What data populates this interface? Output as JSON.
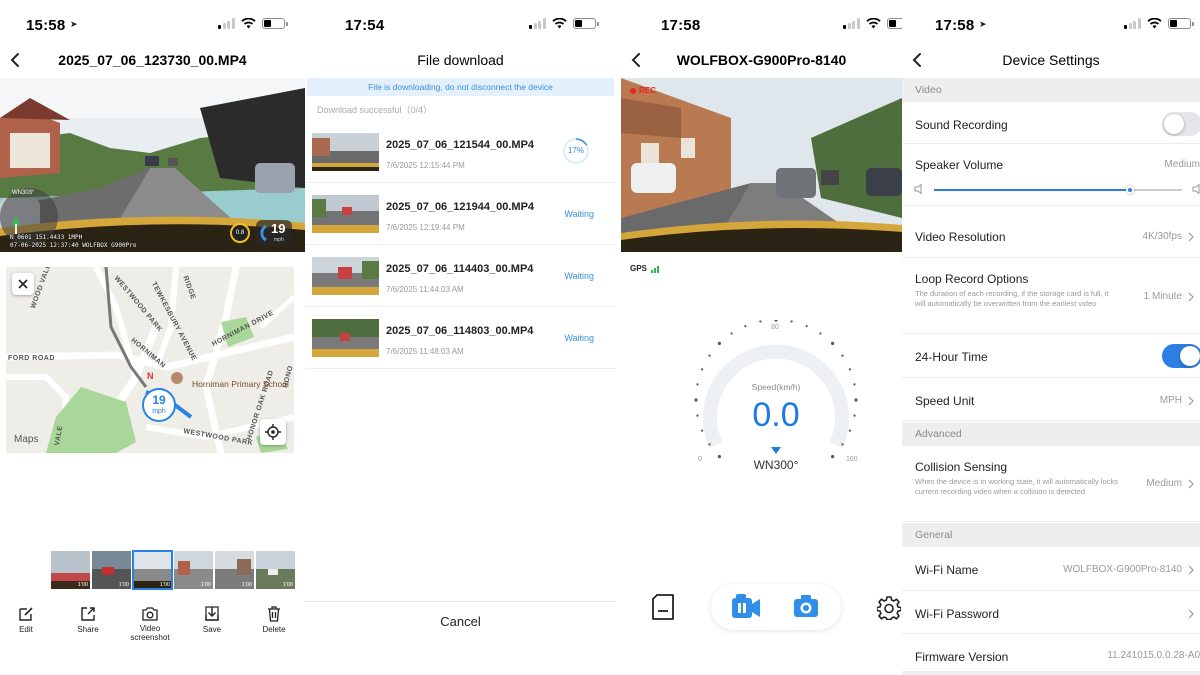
{
  "panel1": {
    "status_time": "15:58",
    "title": "2025_07_06_123730_00.MP4",
    "video_overlay": {
      "heading": "WN303°",
      "osd_line1": "N 0601 151.4433 1MPH",
      "osd_line2": "07-06-2025 12:37:40 WOLFBOX G900Pro",
      "gauge_value": "0.8",
      "speed_value": "19",
      "speed_unit": "mph"
    },
    "map": {
      "roads": [
        "WOOD VALE",
        "FORD ROAD",
        "WESTWOOD PARK",
        "TEWKESBURY AVENUE",
        "HORNIMAN DRIVE",
        "HONOR OAK ROAD",
        "WESTWOOD PARK",
        "VALE",
        "RIDGE",
        "HORNIMAN",
        "HONO"
      ],
      "poi": "Horniman Primary School",
      "compass": "N",
      "speed": "19",
      "speed_unit": "mph",
      "attribution": "Maps"
    },
    "thumbnails": [
      {
        "duration": "1'00"
      },
      {
        "duration": "1'00"
      },
      {
        "duration": "1'00"
      },
      {
        "duration": "1'00"
      },
      {
        "duration": "1'00"
      },
      {
        "duration": "1'00"
      }
    ],
    "toolbar": {
      "edit": "Edit",
      "share": "Share",
      "screenshot": "Video screenshot",
      "save": "Save",
      "delete": "Delete"
    }
  },
  "panel2": {
    "status_time": "17:54",
    "title": "File download",
    "banner": "File is downloading, do not disconnect the device",
    "download_summary": "Download successful（0/4）",
    "files": [
      {
        "name": "2025_07_06_121544_00.MP4",
        "date": "7/6/2025 12:15:44 PM",
        "status": "17%",
        "progress": 0.17
      },
      {
        "name": "2025_07_06_121944_00.MP4",
        "date": "7/6/2025 12:19:44 PM",
        "status": "Waiting"
      },
      {
        "name": "2025_07_06_114403_00.MP4",
        "date": "7/6/2025 11:44:03 AM",
        "status": "Waiting"
      },
      {
        "name": "2025_07_06_114803_00.MP4",
        "date": "7/6/2025 11:48:03 AM",
        "status": "Waiting"
      }
    ],
    "cancel": "Cancel"
  },
  "panel3": {
    "status_time": "17:58",
    "title": "WOLFBOX-G900Pro-8140",
    "rec_label": "REC",
    "gps_label": "GPS",
    "gauge": {
      "label": "Speed(km/h)",
      "value": "0.0",
      "heading": "WN300°",
      "tick_min": "0",
      "tick_mid": "80",
      "tick_max": "160"
    },
    "colors": {
      "accent": "#1f7ae0",
      "rec": "#e22222"
    }
  },
  "panel4": {
    "status_time": "17:58",
    "title": "Device Settings",
    "sections": {
      "video": "Video",
      "advanced": "Advanced",
      "general": "General"
    },
    "rows": {
      "sound_recording": {
        "label": "Sound Recording",
        "on": false
      },
      "speaker_volume": {
        "label": "Speaker Volume",
        "value": "Medium",
        "level": 0.79
      },
      "video_resolution": {
        "label": "Video Resolution",
        "value": "4K/30fps"
      },
      "loop_record": {
        "label": "Loop Record Options",
        "desc": "The duration of each recording, if the storage card is full, it will automatically be overwritten from the earliest video",
        "value": "1 Minute"
      },
      "hour24": {
        "label": "24-Hour Time",
        "on": true
      },
      "speed_unit": {
        "label": "Speed Unit",
        "value": "MPH"
      },
      "collision": {
        "label": "Collision Sensing",
        "desc": "When the device is in working state, it will automatically locks current recording video when a collision is detected",
        "value": "Medium"
      },
      "wifi_name": {
        "label": "Wi-Fi Name",
        "value": "WOLFBOX-G900Pro-8140"
      },
      "wifi_password": {
        "label": "Wi-Fi Password"
      },
      "firmware": {
        "label": "Firmware Version",
        "value": "11.241015.0.0.28-A0"
      }
    },
    "colors": {
      "toggle_on": "#2a7fe0"
    }
  }
}
